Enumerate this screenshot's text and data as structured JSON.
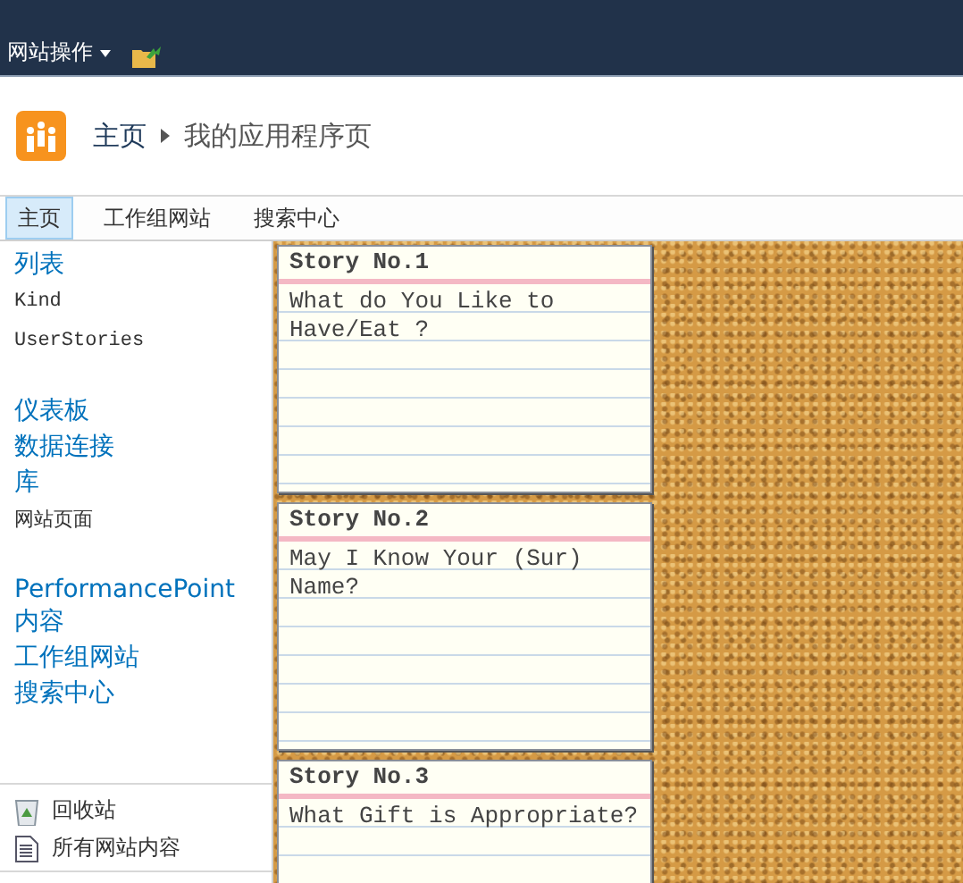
{
  "top_bar": {
    "site_actions": "网站操作"
  },
  "header": {
    "breadcrumb": [
      {
        "label": "主页",
        "kind": "link"
      },
      {
        "label": "我的应用程序页",
        "kind": "current"
      }
    ]
  },
  "tabs": [
    {
      "label": "主页",
      "selected": true
    },
    {
      "label": "工作组网站",
      "selected": false
    },
    {
      "label": "搜索中心",
      "selected": false
    }
  ],
  "sidebar": {
    "groups": [
      {
        "items": [
          {
            "label": "列表",
            "kind": "heading"
          },
          {
            "label": "Kind",
            "kind": "code"
          },
          {
            "label": "UserStories",
            "kind": "code"
          }
        ]
      },
      {
        "items": [
          {
            "label": "仪表板",
            "kind": "heading"
          },
          {
            "label": "数据连接",
            "kind": "heading"
          },
          {
            "label": "库",
            "kind": "heading"
          },
          {
            "label": "网站页面",
            "kind": "sub"
          }
        ]
      },
      {
        "items": [
          {
            "label": "PerformancePoint 内容",
            "kind": "heading"
          },
          {
            "label": "工作组网站",
            "kind": "heading"
          },
          {
            "label": "搜索中心",
            "kind": "heading"
          }
        ]
      }
    ],
    "footer": [
      {
        "label": "回收站",
        "kind": "recycle"
      },
      {
        "label": "所有网站内容",
        "kind": "content"
      }
    ]
  },
  "stories": [
    {
      "title": "Story No.1",
      "text": "What do You Like to Have/Eat ?"
    },
    {
      "title": "Story No.2",
      "text": "May I Know Your (Sur) Name?"
    },
    {
      "title": "Story No.3",
      "text": "What Gift is Appropriate?"
    }
  ]
}
